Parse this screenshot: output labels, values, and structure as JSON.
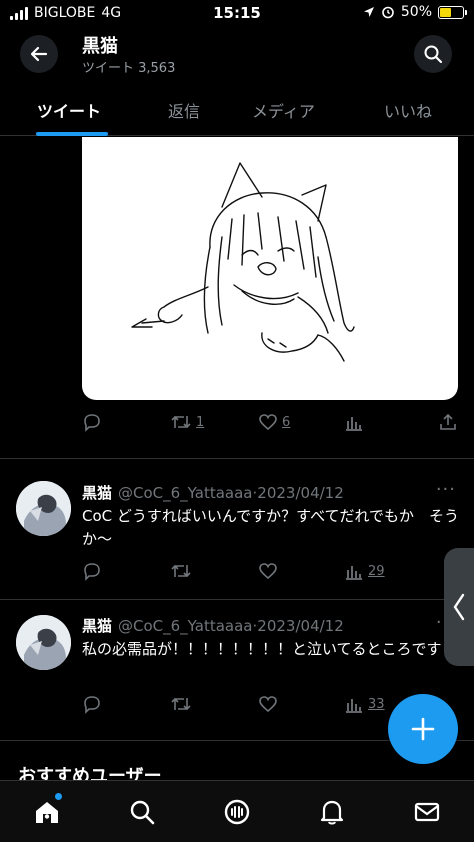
{
  "status_bar": {
    "carrier": "BIGLOBE",
    "network": "4G",
    "time": "15:15",
    "battery": "50%",
    "battery_level": 0.5
  },
  "header": {
    "title": "黒猫",
    "subtitle": "ツイート 3,563"
  },
  "tabs": [
    {
      "label": "ツイート",
      "active": true
    },
    {
      "label": "返信"
    },
    {
      "label": "メディア"
    },
    {
      "label": "いいね"
    }
  ],
  "media_tweet": {
    "retweets": "1",
    "likes": "6"
  },
  "tweets": [
    {
      "name": "黒猫",
      "handle": "@CoC_6_Yattaaaa",
      "date": "2023/04/12",
      "text": "CoC どうすればいいんですか？すべてだれでもか　そうか〜",
      "views": "29"
    },
    {
      "name": "黒猫",
      "handle": "@CoC_6_Yattaaaa",
      "date": "2023/04/12",
      "text": "私の必需品が！！！！！！！！と泣いてるところです",
      "views": "33"
    }
  ],
  "section": {
    "title": "おすすめユーザー"
  },
  "colors": {
    "accent": "#1d9bf0",
    "background": "#000000",
    "muted": "#71767b"
  }
}
